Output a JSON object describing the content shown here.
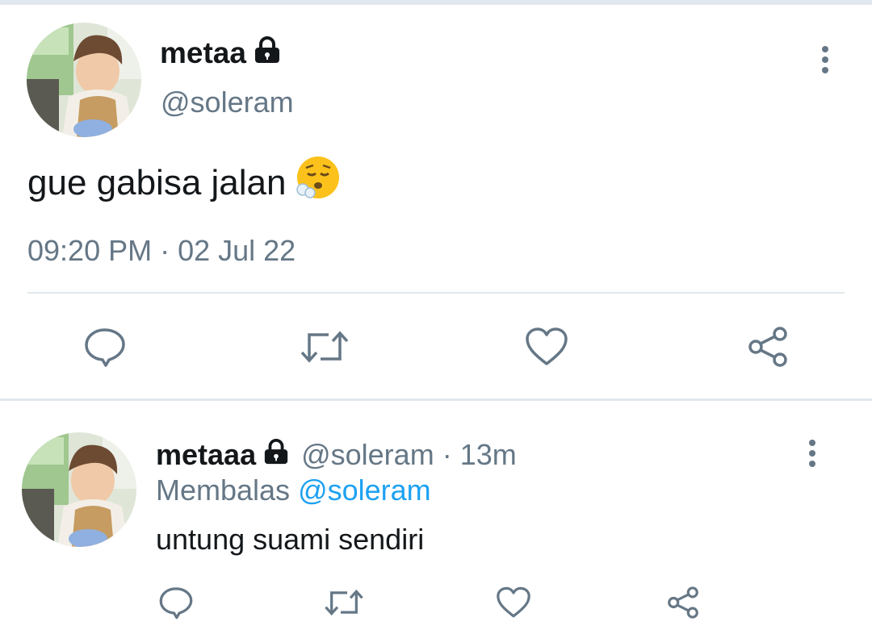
{
  "main_tweet": {
    "display_name": "metaa",
    "handle": "@soleram",
    "text": "gue gabisa jalan",
    "emoji": "face-exhaling-emoji",
    "timestamp": "09:20 PM · 02 Jul 22",
    "protected_icon": "lock-icon",
    "more_icon": "more-vertical-icon"
  },
  "actions": [
    {
      "name": "reply",
      "icon": "reply-icon"
    },
    {
      "name": "retweet",
      "icon": "retweet-icon"
    },
    {
      "name": "like",
      "icon": "heart-icon"
    },
    {
      "name": "share",
      "icon": "share-icon"
    }
  ],
  "reply_tweet": {
    "display_name": "metaaa",
    "handle": "@soleram",
    "separator": "·",
    "time_ago": "13m",
    "replying_label": "Membalas",
    "replying_to": "@soleram",
    "text": "untung suami sendiri",
    "protected_icon": "lock-icon",
    "more_icon": "more-vertical-icon"
  },
  "colors": {
    "text": "#14171a",
    "muted": "#657786",
    "link": "#1da1f2",
    "divider": "#e1e8ed"
  }
}
